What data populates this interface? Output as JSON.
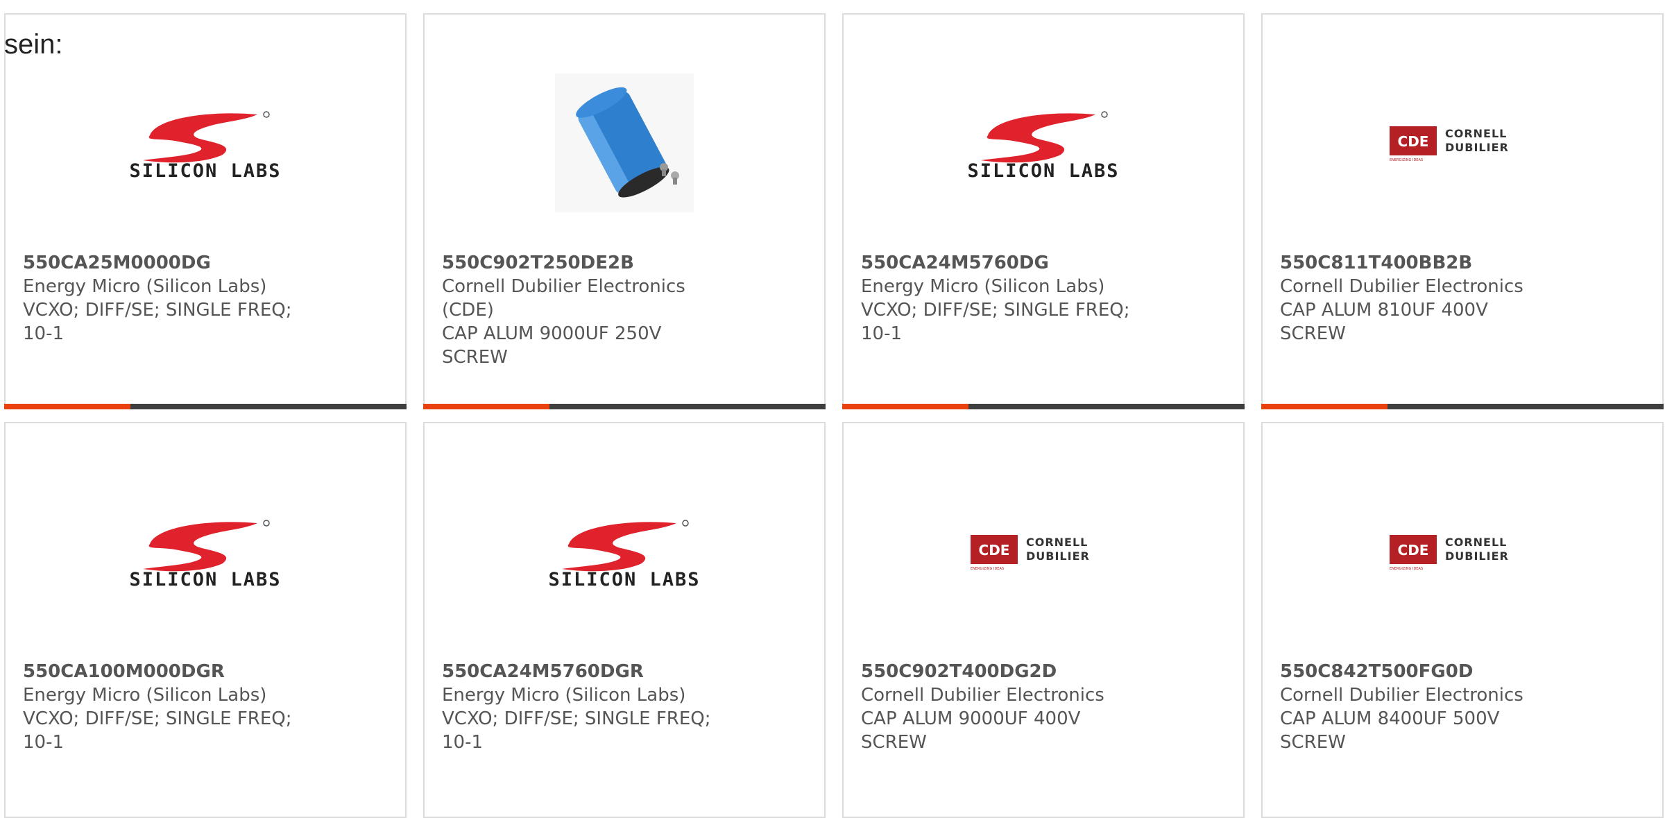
{
  "heading": "sein:",
  "colors": {
    "accent": "#e8410e",
    "bar": "#3f3f3f",
    "silicon_red": "#e0222d",
    "cde_red": "#b52025"
  },
  "cards": [
    {
      "mpn": "550CA25M0000DG",
      "manufacturer": "Energy Micro (Silicon Labs)",
      "desc_line1": "VCXO; DIFF/SE; SINGLE FREQ;",
      "desc_line2": "10-1",
      "logo": "silicon-labs-logo",
      "logo_text": "SILICON LABS"
    },
    {
      "mpn": "550C902T250DE2B",
      "manufacturer": "Cornell Dubilier Electronics (CDE)",
      "desc_line1": "CAP ALUM 9000UF 250V SCREW",
      "desc_line2": "",
      "logo": "capacitor-photo",
      "logo_text": ""
    },
    {
      "mpn": "550CA24M5760DG",
      "manufacturer": "Energy Micro (Silicon Labs)",
      "desc_line1": "VCXO; DIFF/SE; SINGLE FREQ;",
      "desc_line2": "10-1",
      "logo": "silicon-labs-logo",
      "logo_text": "SILICON LABS"
    },
    {
      "mpn": "550C811T400BB2B",
      "manufacturer": "Cornell Dubilier Electronics",
      "desc_line1": "CAP ALUM 810UF 400V SCREW",
      "desc_line2": "",
      "logo": "cornell-dubilier-logo",
      "logo_text": "CORNELL DUBILIER"
    },
    {
      "mpn": "550CA100M000DGR",
      "manufacturer": "Energy Micro (Silicon Labs)",
      "desc_line1": "VCXO; DIFF/SE; SINGLE FREQ;",
      "desc_line2": "10-1",
      "logo": "silicon-labs-logo",
      "logo_text": "SILICON LABS"
    },
    {
      "mpn": "550CA24M5760DGR",
      "manufacturer": "Energy Micro (Silicon Labs)",
      "desc_line1": "VCXO; DIFF/SE; SINGLE FREQ;",
      "desc_line2": "10-1",
      "logo": "silicon-labs-logo",
      "logo_text": "SILICON LABS"
    },
    {
      "mpn": "550C902T400DG2D",
      "manufacturer": "Cornell Dubilier Electronics",
      "desc_line1": "CAP ALUM 9000UF 400V SCREW",
      "desc_line2": "",
      "logo": "cornell-dubilier-logo",
      "logo_text": "CORNELL DUBILIER"
    },
    {
      "mpn": "550C842T500FG0D",
      "manufacturer": "Cornell Dubilier Electronics",
      "desc_line1": "CAP ALUM 8400UF 500V SCREW",
      "desc_line2": "",
      "logo": "cornell-dubilier-logo",
      "logo_text": "CORNELL DUBILIER"
    }
  ]
}
